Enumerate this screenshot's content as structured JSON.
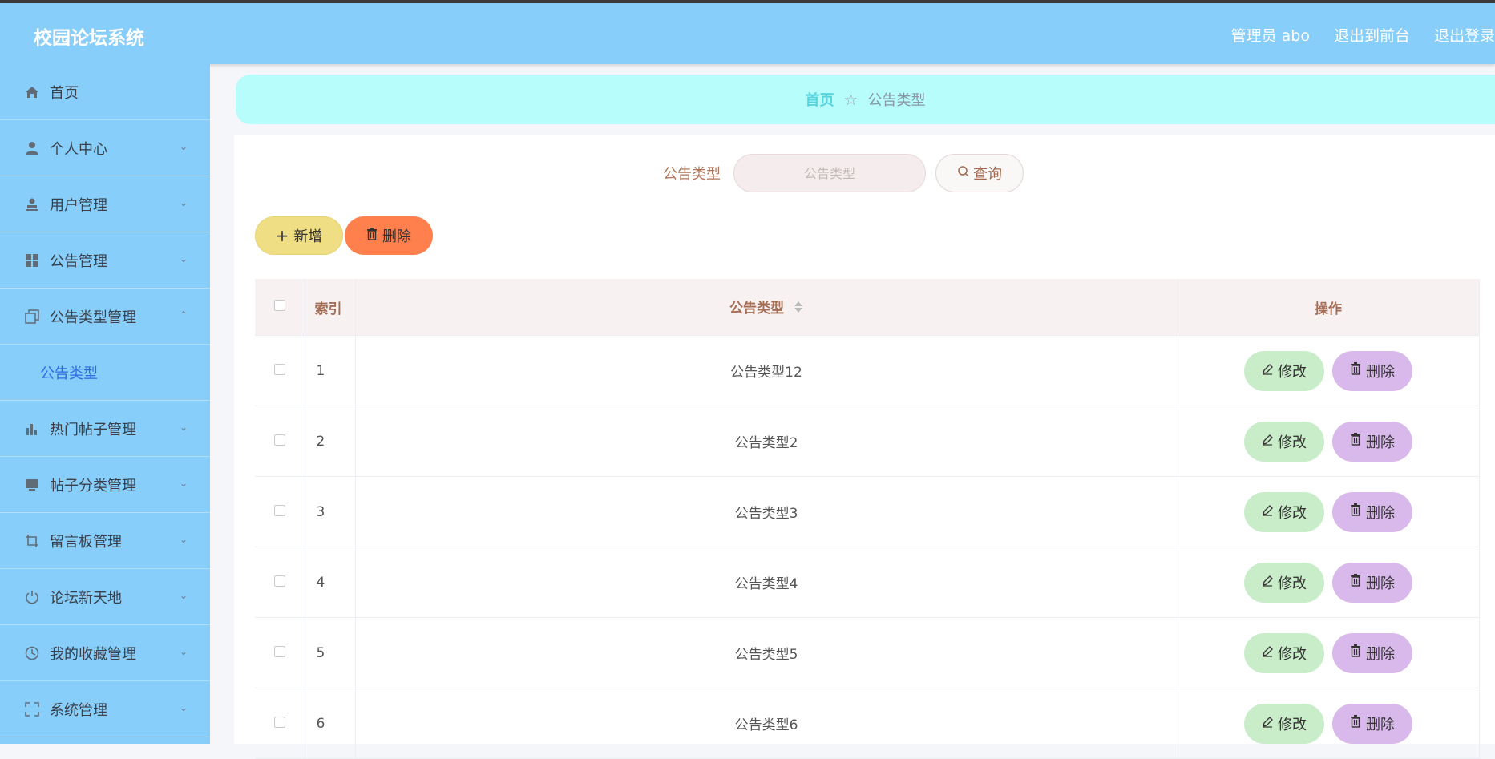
{
  "header": {
    "title": "校园论坛系统",
    "admin_label": "管理员 abo",
    "to_frontend": "退出到前台",
    "logout": "退出登录"
  },
  "sidebar": {
    "items": [
      {
        "label": "首页",
        "icon": "home-icon"
      },
      {
        "label": "个人中心",
        "icon": "user-icon"
      },
      {
        "label": "用户管理",
        "icon": "user-stamp-icon"
      },
      {
        "label": "公告管理",
        "icon": "grid-icon"
      },
      {
        "label": "公告类型管理",
        "icon": "copy-icon"
      },
      {
        "label": "公告类型",
        "icon": ""
      },
      {
        "label": "热门帖子管理",
        "icon": "bar-chart-icon"
      },
      {
        "label": "帖子分类管理",
        "icon": "monitor-icon"
      },
      {
        "label": "留言板管理",
        "icon": "crop-icon"
      },
      {
        "label": "论坛新天地",
        "icon": "power-icon"
      },
      {
        "label": "我的收藏管理",
        "icon": "clock-icon"
      },
      {
        "label": "系统管理",
        "icon": "fullscreen-icon"
      }
    ],
    "active_sub": "公告类型"
  },
  "breadcrumb": {
    "home": "首页",
    "current": "公告类型"
  },
  "search": {
    "label": "公告类型",
    "placeholder": "公告类型",
    "button": "查询"
  },
  "actions": {
    "add": "新增",
    "delete": "删除"
  },
  "table": {
    "columns": {
      "index": "索引",
      "type": "公告类型",
      "ops": "操作"
    },
    "rows": [
      {
        "index": "1",
        "type": "公告类型12"
      },
      {
        "index": "2",
        "type": "公告类型2"
      },
      {
        "index": "3",
        "type": "公告类型3"
      },
      {
        "index": "4",
        "type": "公告类型4"
      },
      {
        "index": "5",
        "type": "公告类型5"
      },
      {
        "index": "6",
        "type": "公告类型6"
      }
    ],
    "edit_label": "修改",
    "delete_label": "删除"
  },
  "colors": {
    "header_bg": "#87cefa",
    "breadcrumb_bg": "#b6fdfb",
    "add_button": "#f0de84",
    "batch_delete_button": "#ff7f4d",
    "edit_button": "#c9ecc9",
    "delete_button": "#d9b8eb"
  }
}
